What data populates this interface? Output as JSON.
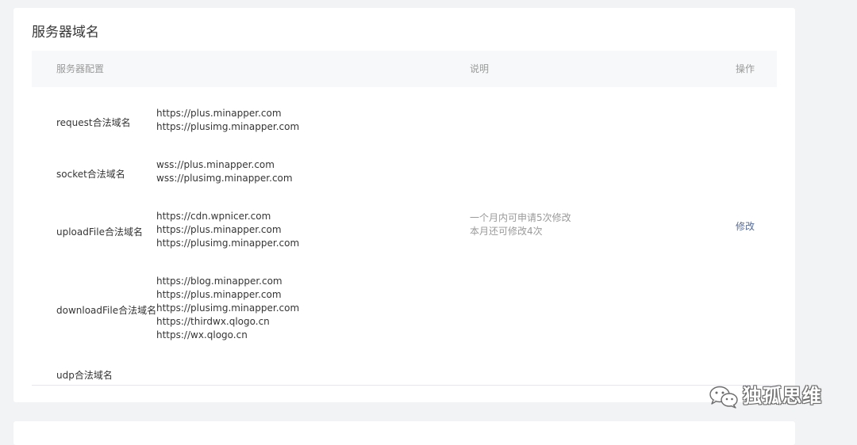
{
  "section": {
    "title": "服务器域名"
  },
  "table": {
    "headers": {
      "config": "服务器配置",
      "description": "说明",
      "operation": "操作"
    },
    "rows": [
      {
        "label": "request合法域名",
        "domains": [
          "https://plus.minapper.com",
          "https://plusimg.minapper.com"
        ]
      },
      {
        "label": "socket合法域名",
        "domains": [
          "wss://plus.minapper.com",
          "wss://plusimg.minapper.com"
        ]
      },
      {
        "label": "uploadFile合法域名",
        "domains": [
          "https://cdn.wpnicer.com",
          "https://plus.minapper.com",
          "https://plusimg.minapper.com"
        ]
      },
      {
        "label": "downloadFile合法域名",
        "domains": [
          "https://blog.minapper.com",
          "https://plus.minapper.com",
          "https://plusimg.minapper.com",
          "https://thirdwx.qlogo.cn",
          "https://wx.qlogo.cn"
        ]
      },
      {
        "label": "udp合法域名",
        "domains": []
      }
    ],
    "description_lines": [
      "一个月内可申请5次修改",
      "本月还可修改4次"
    ],
    "modify_link": "修改"
  },
  "watermark": {
    "text": "独孤思维",
    "icon": "wechat-icon"
  }
}
